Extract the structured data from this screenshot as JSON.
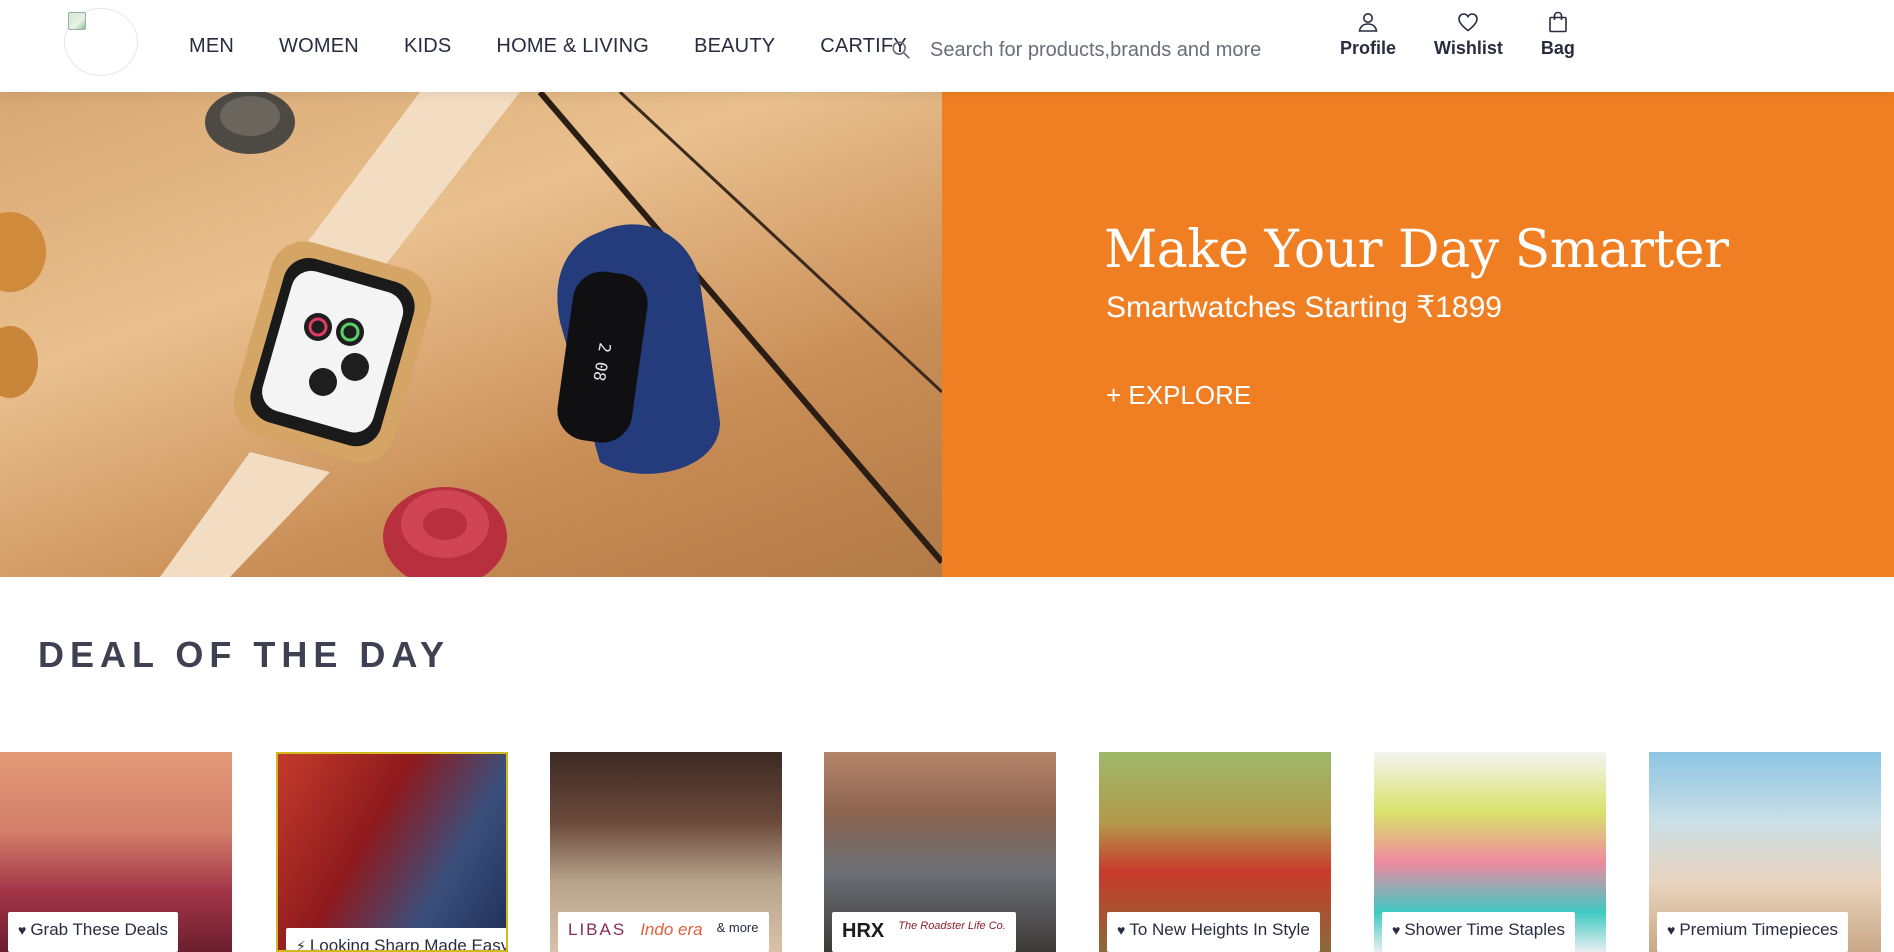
{
  "nav": {
    "items": [
      "MEN",
      "WOMEN",
      "KIDS",
      "HOME & LIVING",
      "BEAUTY",
      "CARTIFY"
    ]
  },
  "search": {
    "placeholder": "Search for products,brands and more"
  },
  "actions": {
    "profile": "Profile",
    "wishlist": "Wishlist",
    "bag": "Bag"
  },
  "hero": {
    "title": "Make Your Day Smarter",
    "subtitle": "Smartwatches Starting ₹1899",
    "cta": "+ EXPLORE",
    "panel_color": "#f07f23"
  },
  "section": {
    "title": "DEAL OF THE DAY"
  },
  "deals": [
    {
      "label": "Grab These Deals",
      "icon": "heart-icon"
    },
    {
      "label": "Looking Sharp Made Easy",
      "icon": "lightning-icon"
    },
    {
      "brands": [
        "LIBAS",
        "Indo era",
        "& more"
      ]
    },
    {
      "brands": [
        "HRX",
        "The Roadster Life Co."
      ]
    },
    {
      "label": "To New Heights In Style",
      "icon": "heart-icon"
    },
    {
      "label": "Shower Time Staples",
      "icon": "heart-icon"
    },
    {
      "label": "Premium Timepieces",
      "icon": "heart-icon"
    }
  ]
}
